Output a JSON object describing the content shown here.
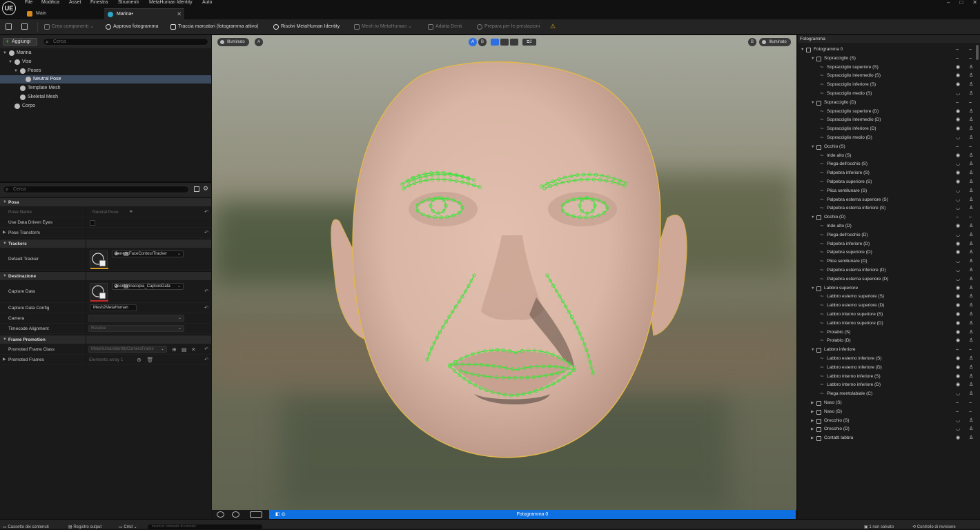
{
  "app": {
    "logo": "UE"
  },
  "menu": [
    "File",
    "Modifica",
    "Asset",
    "Finestra",
    "Strumenti",
    "MetaHuman Identity",
    "Auto"
  ],
  "window_controls": [
    "–",
    "□",
    "✕"
  ],
  "tabs": [
    {
      "label": "Main",
      "active": false
    },
    {
      "label": "Marina•",
      "active": true
    }
  ],
  "toolbar": {
    "items": [
      {
        "label": "Crea componenti",
        "caret": "⌄",
        "enabled": false
      },
      {
        "label": "Approva fotogramma",
        "enabled": true
      },
      {
        "label": "Traccia marcatori (fotogramma attivo)",
        "enabled": true
      },
      {
        "label": "Risolvi MetaHuman Identity",
        "enabled": true
      },
      {
        "label": "Mesh to MetaHuman",
        "caret": "⌄",
        "enabled": false
      },
      {
        "label": "Adatta Denti",
        "enabled": false
      },
      {
        "label": "Prepara per le prestazioni",
        "enabled": false
      }
    ],
    "warning_icon": "⚠"
  },
  "outliner": {
    "add_label": "Aggiungi",
    "add_plus": "+",
    "search_placeholder": "Cerca",
    "tree": [
      {
        "label": "Marina",
        "level": 0,
        "expanded": true,
        "selected": false,
        "icon": "identity-icon"
      },
      {
        "label": "Viso",
        "level": 1,
        "expanded": true,
        "selected": false,
        "icon": "face-icon"
      },
      {
        "label": "Poses",
        "level": 2,
        "expanded": true,
        "selected": false,
        "icon": "poses-icon"
      },
      {
        "label": "Neutral Pose",
        "level": 3,
        "expanded": null,
        "selected": true,
        "icon": "neutral-pose-icon"
      },
      {
        "label": "Template Mesh",
        "level": 2,
        "expanded": null,
        "selected": false,
        "icon": "template-mesh-icon"
      },
      {
        "label": "Skeletal Mesh",
        "level": 2,
        "expanded": null,
        "selected": false,
        "icon": "skeletal-mesh-icon"
      },
      {
        "label": "Corpo",
        "level": 1,
        "expanded": null,
        "selected": false,
        "icon": "body-icon"
      }
    ]
  },
  "details": {
    "search_placeholder": "Cerca",
    "sections": {
      "posa": "Posa",
      "trackers": "Trackers",
      "destinazione": "Destinazione",
      "frame_promotion": "Frame Promotion"
    },
    "props": {
      "pose_name": {
        "label": "Pose Name",
        "value": "Neutral Pose"
      },
      "use_data_driven_eyes": {
        "label": "Use Data Driven Eyes"
      },
      "pose_transform": {
        "label": "Pose Transform"
      },
      "default_tracker": {
        "label": "Default Tracker",
        "value": "GenericFaceContourTracker"
      },
      "capture_data": {
        "label": "Capture Data",
        "value": "visomarinacopia_CaptureData"
      },
      "capture_data_config": {
        "label": "Capture Data Config",
        "value": "Mesh2MetaHuman"
      },
      "camera": {
        "label": "Camera",
        "value": ""
      },
      "timecode_alignment": {
        "label": "Timecode Alignment",
        "value": "Relative"
      },
      "promoted_frame_class": {
        "label": "Promoted Frame Class",
        "value": "MetaHumanIdentityCameraFrame"
      },
      "promoted_frames": {
        "label": "Promoted Frames",
        "value": "Elemento array 1"
      }
    }
  },
  "viewport": {
    "left_view_label": "Illuminato",
    "left_view_letter": "A",
    "right_view_label": "Illuminato",
    "right_view_letter": "B",
    "ab_left": "A",
    "ab_right": "B",
    "camera_count": "2"
  },
  "timeline": {
    "frame_label": "Fotogramma 0"
  },
  "statusbar": {
    "content_drawer": "Cassetto dei contenuti",
    "output_log": "Registro output",
    "cmd": "Cmd",
    "cmd_placeholder": "Inserisci comando di console",
    "unsaved": "1 non salvato",
    "revision": "Controllo di revisione"
  },
  "frames_panel": {
    "title": "Fotogramma",
    "rows": [
      {
        "label": "Fotogramma 0",
        "level": 0,
        "group": true,
        "expanded": true,
        "eye": "–",
        "lock": "–"
      },
      {
        "label": "Sopracciglio (S)",
        "level": 1,
        "group": true,
        "expanded": true,
        "eye": "–",
        "lock": "–"
      },
      {
        "label": "Sopracciglio superiore (S)",
        "level": 2,
        "group": false,
        "eye": "◉",
        "lock": "♙"
      },
      {
        "label": "Sopracciglio intermedio (S)",
        "level": 2,
        "group": false,
        "eye": "◉",
        "lock": "♙"
      },
      {
        "label": "Sopracciglio inferiore (S)",
        "level": 2,
        "group": false,
        "eye": "◉",
        "lock": "♙"
      },
      {
        "label": "Sopracciglio medio (S)",
        "level": 2,
        "group": false,
        "eye": "◡",
        "lock": "♙"
      },
      {
        "label": "Sopracciglio (D)",
        "level": 1,
        "group": true,
        "expanded": true,
        "eye": "–",
        "lock": "–"
      },
      {
        "label": "Sopracciglio superiore (D)",
        "level": 2,
        "group": false,
        "eye": "◉",
        "lock": "♙"
      },
      {
        "label": "Sopracciglio intermedio (D)",
        "level": 2,
        "group": false,
        "eye": "◉",
        "lock": "♙"
      },
      {
        "label": "Sopracciglio inferiore (D)",
        "level": 2,
        "group": false,
        "eye": "◉",
        "lock": "♙"
      },
      {
        "label": "Sopracciglio medio (D)",
        "level": 2,
        "group": false,
        "eye": "◡",
        "lock": "♙"
      },
      {
        "label": "Occhio (S)",
        "level": 1,
        "group": true,
        "expanded": true,
        "eye": "–",
        "lock": "–"
      },
      {
        "label": "Iride alto (S)",
        "level": 2,
        "group": false,
        "eye": "◉",
        "lock": "♙"
      },
      {
        "label": "Piega dell'occhio (S)",
        "level": 2,
        "group": false,
        "eye": "◡",
        "lock": "♙"
      },
      {
        "label": "Palpebra inferiore (S)",
        "level": 2,
        "group": false,
        "eye": "◉",
        "lock": "♙"
      },
      {
        "label": "Palpebra superiore (S)",
        "level": 2,
        "group": false,
        "eye": "◉",
        "lock": "♙"
      },
      {
        "label": "Plica semilunare (S)",
        "level": 2,
        "group": false,
        "eye": "◡",
        "lock": "♙"
      },
      {
        "label": "Palpebra esterna superiore (S)",
        "level": 2,
        "group": false,
        "eye": "◡",
        "lock": "♙"
      },
      {
        "label": "Palpebra esterna inferiore (S)",
        "level": 2,
        "group": false,
        "eye": "◡",
        "lock": "♙"
      },
      {
        "label": "Occhio (D)",
        "level": 1,
        "group": true,
        "expanded": true,
        "eye": "–",
        "lock": "–"
      },
      {
        "label": "Iride alto (D)",
        "level": 2,
        "group": false,
        "eye": "◉",
        "lock": "♙"
      },
      {
        "label": "Piega dell'occhio (D)",
        "level": 2,
        "group": false,
        "eye": "◡",
        "lock": "♙"
      },
      {
        "label": "Palpebra inferiore (D)",
        "level": 2,
        "group": false,
        "eye": "◉",
        "lock": "♙"
      },
      {
        "label": "Palpebra superiore (D)",
        "level": 2,
        "group": false,
        "eye": "◉",
        "lock": "♙"
      },
      {
        "label": "Plica semilunare (D)",
        "level": 2,
        "group": false,
        "eye": "◡",
        "lock": "♙"
      },
      {
        "label": "Palpebra esterna inferiore (D)",
        "level": 2,
        "group": false,
        "eye": "◡",
        "lock": "♙"
      },
      {
        "label": "Palpebra esterna superiore (D)",
        "level": 2,
        "group": false,
        "eye": "◡",
        "lock": "♙"
      },
      {
        "label": "Labbro superiore",
        "level": 1,
        "group": true,
        "expanded": true,
        "eye": "◉",
        "lock": "♙"
      },
      {
        "label": "Labbro esterno superiore (S)",
        "level": 2,
        "group": false,
        "eye": "◉",
        "lock": "♙"
      },
      {
        "label": "Labbro esterno superiore (D)",
        "level": 2,
        "group": false,
        "eye": "◉",
        "lock": "♙"
      },
      {
        "label": "Labbro interno superiore (S)",
        "level": 2,
        "group": false,
        "eye": "◉",
        "lock": "♙"
      },
      {
        "label": "Labbro interno superiore (D)",
        "level": 2,
        "group": false,
        "eye": "◉",
        "lock": "♙"
      },
      {
        "label": "Prolabio (S)",
        "level": 2,
        "group": false,
        "eye": "◉",
        "lock": "♙"
      },
      {
        "label": "Prolabio (D)",
        "level": 2,
        "group": false,
        "eye": "◉",
        "lock": "♙"
      },
      {
        "label": "Labbro inferiore",
        "level": 1,
        "group": true,
        "expanded": true,
        "eye": "–",
        "lock": "–"
      },
      {
        "label": "Labbro esterno inferiore (S)",
        "level": 2,
        "group": false,
        "eye": "◉",
        "lock": "♙"
      },
      {
        "label": "Labbro esterno inferiore (D)",
        "level": 2,
        "group": false,
        "eye": "◉",
        "lock": "♙"
      },
      {
        "label": "Labbro interno inferiore (S)",
        "level": 2,
        "group": false,
        "eye": "◉",
        "lock": "♙"
      },
      {
        "label": "Labbro interno inferiore (D)",
        "level": 2,
        "group": false,
        "eye": "◉",
        "lock": "♙"
      },
      {
        "label": "Piega mentolabiale (C)",
        "level": 2,
        "group": false,
        "eye": "◡",
        "lock": "♙"
      },
      {
        "label": "Naso (S)",
        "level": 1,
        "group": true,
        "expanded": false,
        "eye": "–",
        "lock": "–"
      },
      {
        "label": "Naso (D)",
        "level": 1,
        "group": true,
        "expanded": false,
        "eye": "–",
        "lock": "–"
      },
      {
        "label": "Orecchio (S)",
        "level": 1,
        "group": true,
        "expanded": false,
        "eye": "◡",
        "lock": "♙"
      },
      {
        "label": "Orecchio (D)",
        "level": 1,
        "group": true,
        "expanded": false,
        "eye": "◡",
        "lock": "♙"
      },
      {
        "label": "Contatti labbra",
        "level": 1,
        "group": true,
        "expanded": false,
        "eye": "◉",
        "lock": "♙"
      }
    ]
  },
  "colors": {
    "accent": "#0e6fe0",
    "selection": "#3c4a5e",
    "marker": "#3fe33a",
    "warning": "#e8b30b"
  }
}
